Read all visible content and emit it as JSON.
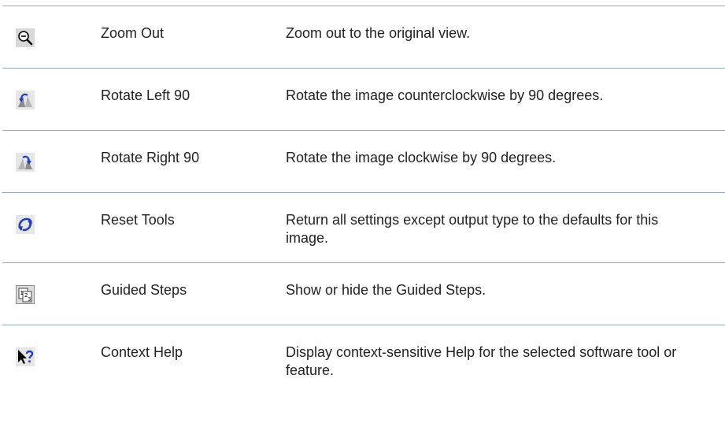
{
  "tools": [
    {
      "icon": "zoom-out-icon",
      "name": "Zoom Out",
      "description": "Zoom out to the original view."
    },
    {
      "icon": "rotate-left-icon",
      "name": "Rotate Left 90",
      "description": "Rotate the image counterclockwise by 90 degrees."
    },
    {
      "icon": "rotate-right-icon",
      "name": "Rotate Right 90",
      "description": "Rotate the image clockwise by 90 degrees."
    },
    {
      "icon": "reset-tools-icon",
      "name": "Reset Tools",
      "description": "Return all settings except output type to the defaults for this image."
    },
    {
      "icon": "guided-steps-icon",
      "name": "Guided Steps",
      "description": "Show or hide the Guided Steps."
    },
    {
      "icon": "context-help-icon",
      "name": "Context Help",
      "description": "Display context-sensitive Help for the selected software tool or feature."
    }
  ],
  "colors": {
    "rule": "#8fa8c2",
    "text": "#222222",
    "icon_blue": "#1f3fbf",
    "icon_gray": "#9a9a9a"
  }
}
